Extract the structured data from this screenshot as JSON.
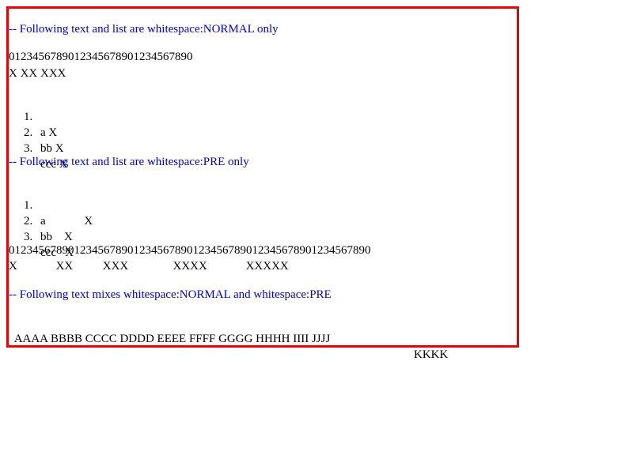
{
  "colors": {
    "border": "#ee0000",
    "comment": "#0000dd",
    "text": "#000000"
  },
  "section1": {
    "comment": "-- Following text and list are whitespace:NORMAL only",
    "ruler": "012345678901234567890123456789 0",
    "ruler_exact": "0123456789012345678901234567890",
    "sample": "X XX XXX",
    "list": [
      {
        "number": "1.",
        "text": "a X"
      },
      {
        "number": "2.",
        "text": "bb X"
      },
      {
        "number": "3.",
        "text": "ccc X"
      }
    ]
  },
  "section2": {
    "comment": "-- Following text and list are whitespace:PRE only",
    "list": [
      {
        "number": "1.",
        "text": "a             X"
      },
      {
        "number": "2.",
        "text": "bb    X"
      },
      {
        "number": "3.",
        "text": "ccc   X"
      }
    ],
    "ruler": "01234567890123456789012345678901234567890123456789012345678901234567890",
    "ruler_exact": "0123456789012345678901234567890123456789012345678901234567890",
    "sample": "X             XX          XXX               XXXX             XXXXX"
  },
  "section3": {
    "comment": "-- Following text mixes whitespace:NORMAL and whitespace:PRE",
    "normal_text": "AAAA BBBB CCCC DDDD EEEE FFFF GGGG HHHH IIII JJJJ",
    "pre_text": "KKKK"
  }
}
